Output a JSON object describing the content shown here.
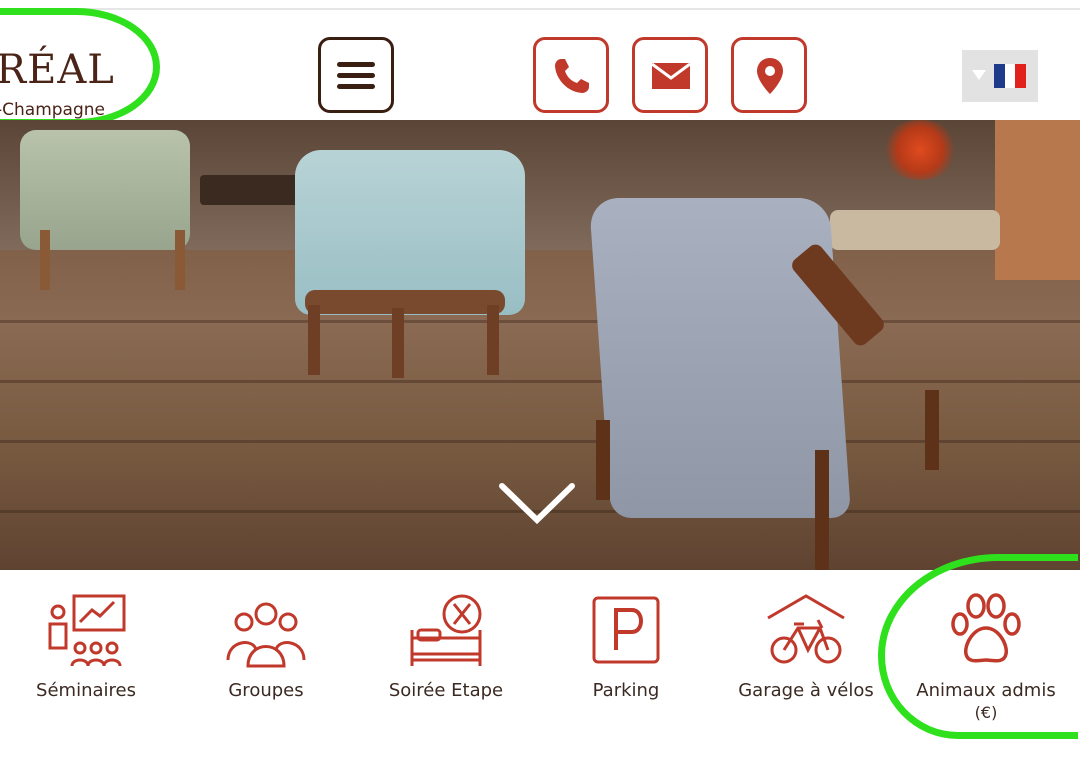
{
  "header": {
    "logo_name": "RÉAL",
    "logo_sub": "-Champagne",
    "menu_label": "menu-icon",
    "contact_icons": [
      "phone-icon",
      "mail-icon",
      "location-pin-icon"
    ],
    "language": {
      "flag": "flag-fr-icon",
      "colors": [
        "#1e3a8a",
        "#ffffff",
        "#e0211d"
      ]
    }
  },
  "hero": {
    "scroll_icon": "chevron-down-icon"
  },
  "amenities": [
    {
      "label": "Séminaires",
      "icon": "seminar-icon"
    },
    {
      "label": "Groupes",
      "icon": "group-icon"
    },
    {
      "label": "Soirée Etape",
      "icon": "bed-dinner-icon"
    },
    {
      "label": "Parking",
      "icon": "parking-icon"
    },
    {
      "label": "Garage à vélos",
      "icon": "bike-garage-icon"
    },
    {
      "label": "Animaux admis\n(€)",
      "line1": "Animaux admis",
      "line2": "(€)",
      "icon": "paw-icon"
    }
  ],
  "colors": {
    "accent": "#c0392b",
    "brand_brown": "#4a2417",
    "highlight": "#2fe01d"
  }
}
